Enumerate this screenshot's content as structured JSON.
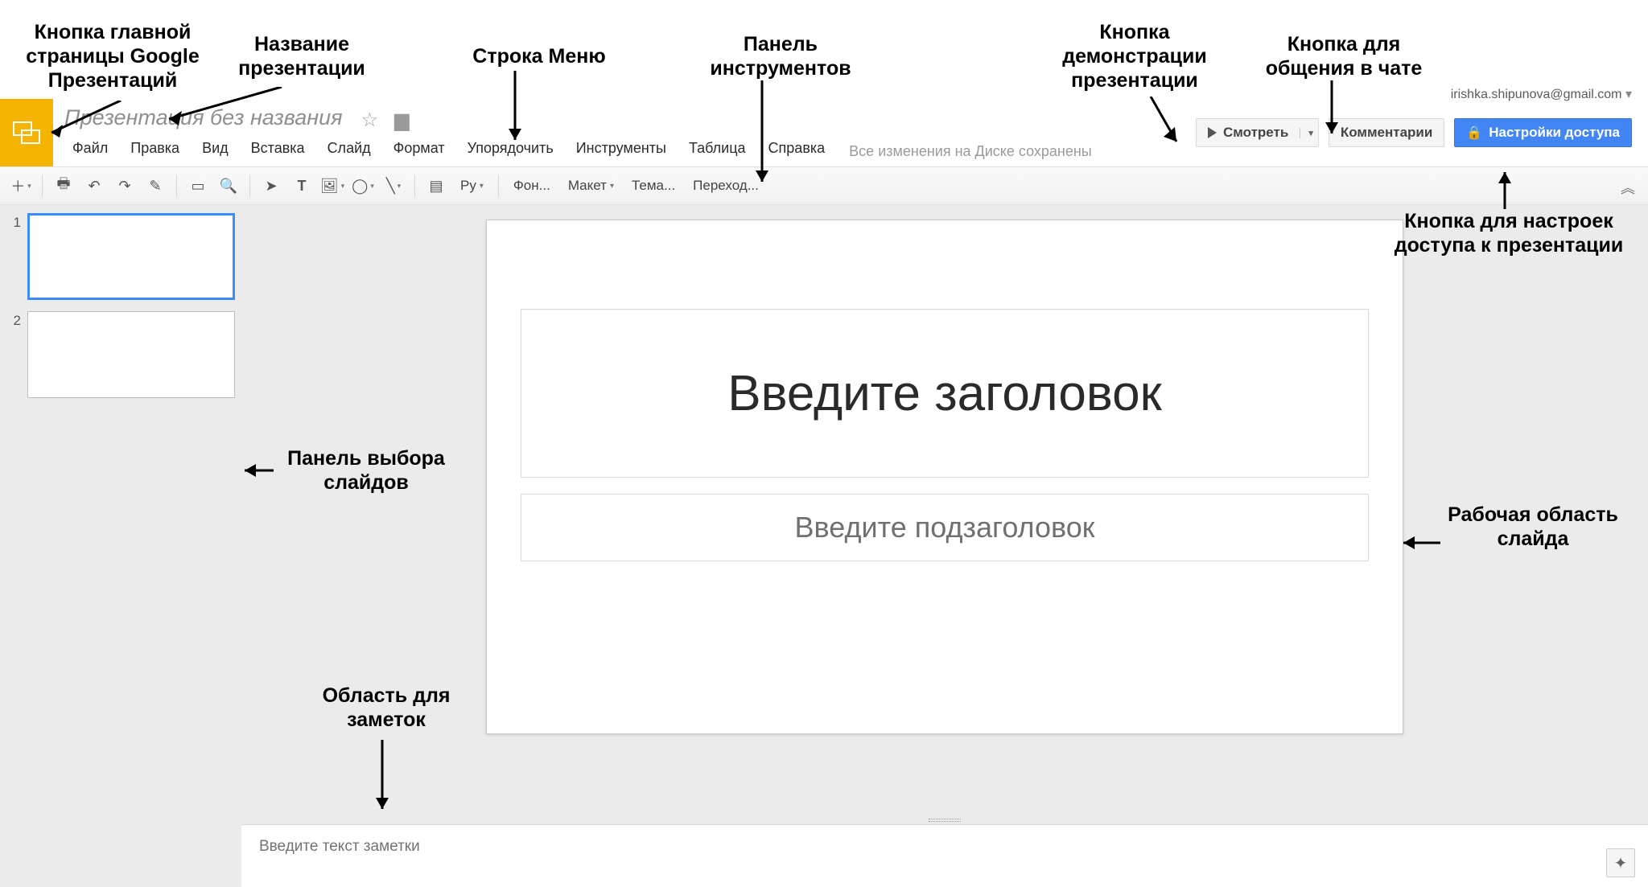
{
  "annotations": {
    "home_btn": "Кнопка главной страницы Google Презентаций",
    "doc_title": "Название презентации",
    "menubar": "Строка Меню",
    "toolbar": "Панель инструментов",
    "present": "Кнопка демонстрации презентации",
    "comments": "Кнопка для общения в чате",
    "share": "Кнопка для настроек доступа к презентации",
    "filmstrip": "Панель выбора слайдов",
    "canvas": "Рабочая область слайда",
    "notes": "Область для заметок"
  },
  "header": {
    "doc_title": "Презентация без названия",
    "saved_msg": "Все изменения на Диске сохранены",
    "user_email": "irishka.shipunova@gmail.com",
    "view_btn": "Смотреть",
    "comments_btn": "Комментарии",
    "share_btn": "Настройки доступа"
  },
  "menu": {
    "file": "Файл",
    "edit": "Правка",
    "view": "Вид",
    "insert": "Вставка",
    "slide": "Слайд",
    "format": "Формат",
    "arrange": "Упорядочить",
    "tools": "Инструменты",
    "table": "Таблица",
    "help": "Справка"
  },
  "toolbar": {
    "py": "Ру",
    "background": "Фон...",
    "layout": "Макет",
    "theme": "Тема...",
    "transition": "Переход..."
  },
  "filmstrip": {
    "slides": [
      {
        "num": "1",
        "active": true
      },
      {
        "num": "2",
        "active": false
      }
    ]
  },
  "slide": {
    "title_placeholder": "Введите заголовок",
    "subtitle_placeholder": "Введите подзаголовок"
  },
  "notes": {
    "placeholder": "Введите текст заметки"
  }
}
